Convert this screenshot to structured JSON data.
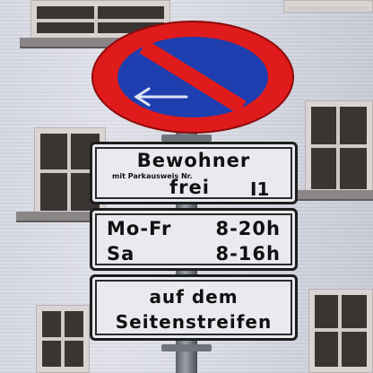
{
  "sign": {
    "top_sign": {
      "meaning": "no-parking",
      "arrow": "left-arrow-icon"
    },
    "plate1": {
      "title": "Bewohner",
      "small": "mit Parkausweis Nr.",
      "frei": "frei",
      "code": "I1"
    },
    "plate2": {
      "row1_label": "Mo-Fr",
      "row1_value": "8-20h",
      "row2_label": "Sa",
      "row2_value": "8-16h"
    },
    "plate3": {
      "line1": "auf dem",
      "line2": "Seitenstreifen"
    }
  },
  "colors": {
    "sign_blue": "#1f3fb0",
    "sign_red": "#e01b1b",
    "plate_bg": "#e9eaef",
    "text": "#111111"
  }
}
